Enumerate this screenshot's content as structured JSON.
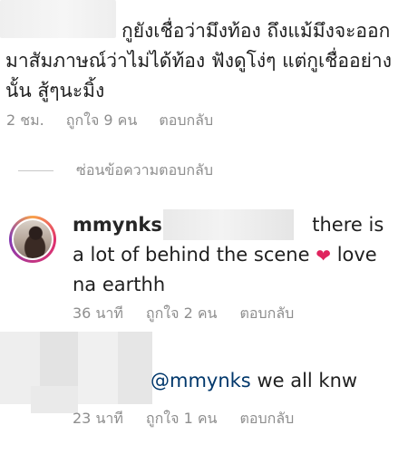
{
  "comment_top": {
    "text": "ยังเชื่อว่ามึงท้อง ถึงแม้มึงจะออกมาสัมภาษณ์ว่าไม่ได้ท้อง ฟังดูโง่ๆ แต่กูเชื่ออย่างนั้น สู้ๆนะมิ้ง",
    "text_visible_prefix": "กู",
    "time": "2 ชม.",
    "likes": "ถูกใจ 9 คน",
    "reply": "ตอบกลับ"
  },
  "hide_replies": {
    "label": "ซ่อนข้อความตอบกลับ"
  },
  "reply_1": {
    "username": "mmynks",
    "text": "there is a lot of behind the scene",
    "text_after": "love na earthh",
    "time": "36 นาที",
    "likes": "ถูกใจ 2 คน",
    "reply": "ตอบกลับ",
    "heart_icon": "heart-icon",
    "heart_color": "#e0245e"
  },
  "reply_2": {
    "mention": "@mmynks",
    "text": "we all knw",
    "time": "23 นาที",
    "likes": "ถูกใจ 1 คน",
    "reply": "ตอบกลับ"
  }
}
